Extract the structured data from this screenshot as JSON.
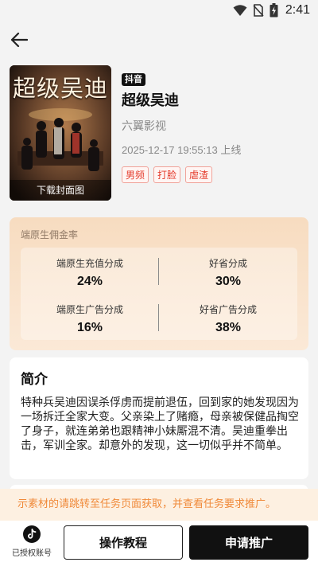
{
  "status_bar": {
    "time": "2:41",
    "icons": [
      "wifi-icon",
      "no-sim-icon",
      "battery-charging-icon"
    ]
  },
  "header": {
    "back_icon": "arrow-left-icon"
  },
  "drama": {
    "cover_title": "超级吴迪",
    "cover_download_label": "下载封面图",
    "platform": "抖音",
    "title": "超级吴迪",
    "studio": "六翼影视",
    "online_time": "2025-12-17 19:55:13 上线",
    "tags": [
      "男频",
      "打脸",
      "虐渣"
    ]
  },
  "commission": {
    "title": "端原生佣金率",
    "rates": [
      {
        "label": "端原生充值分成",
        "value": "24%"
      },
      {
        "label": "好省分成",
        "value": "30%"
      },
      {
        "label": "端原生广告分成",
        "value": "16%"
      },
      {
        "label": "好省广告分成",
        "value": "38%"
      }
    ]
  },
  "intro": {
    "title": "简介",
    "text": "特种兵吴迪因误杀俘虏而提前退伍，回到家的她发现因为一场拆迁全家大变。父亲染上了赌瘾，母亲被保健品掏空了身子，就连弟弟也跟精神小妹厮混不清。吴迪重拳出击，军训全家。却意外的发现，这一切似乎并不简单。"
  },
  "notice": {
    "text": "示素材的请跳转至任务页面获取，并查看任务要求推广。"
  },
  "bottom_bar": {
    "account_label": "已授权账号",
    "tutorial_button": "操作教程",
    "apply_button": "申请推广"
  },
  "colors": {
    "accent": "#111111",
    "tag_red": "#e43b2c",
    "notice_orange": "#f08a3a",
    "commission_bg": "#f7dcc0"
  }
}
